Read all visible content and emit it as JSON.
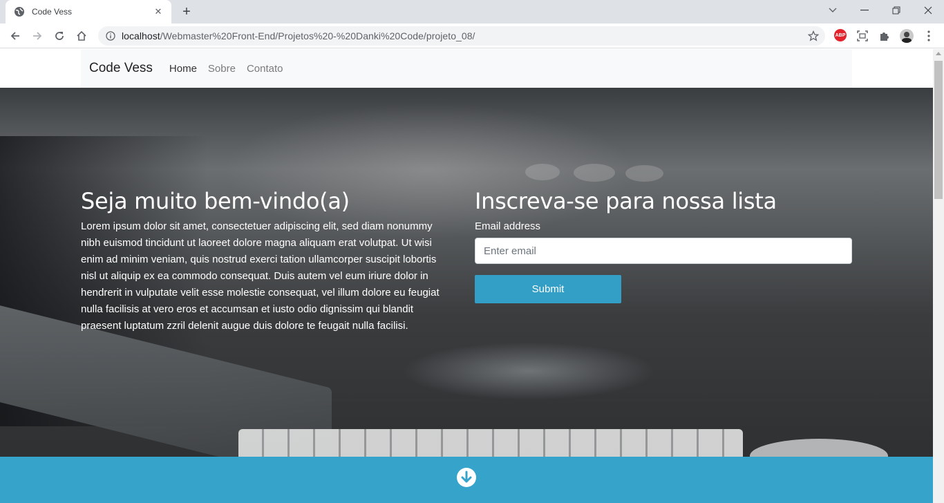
{
  "browser": {
    "tab_title": "Code Vess",
    "url_host": "localhost",
    "url_path": "/Webmaster%20Front-End/Projetos%20-%20Danki%20Code/projeto_08/",
    "abp_label": "ABP"
  },
  "navbar": {
    "brand": "Code Vess",
    "links": [
      "Home",
      "Sobre",
      "Contato"
    ]
  },
  "hero": {
    "title": "Seja muito bem-vindo(a)",
    "text": "Lorem ipsum dolor sit amet, consectetuer adipiscing elit, sed diam nonummy nibh euismod tincidunt ut laoreet dolore magna aliquam erat volutpat. Ut wisi enim ad minim veniam, quis nostrud exerci tation ullamcorper suscipit lobortis nisl ut aliquip ex ea commodo consequat. Duis autem vel eum iriure dolor in hendrerit in vulputate velit esse molestie consequat, vel illum dolore eu feugiat nulla facilisis at vero eros et accumsan et iusto odio dignissim qui blandit praesent luptatum zzril delenit augue duis dolore te feugait nulla facilisi."
  },
  "signup": {
    "title": "Inscreva-se para nossa lista",
    "email_label": "Email address",
    "email_placeholder": "Enter email",
    "submit_label": "Submit"
  },
  "colors": {
    "accent": "#36a3ca",
    "button": "#339fc7",
    "abp": "#e3232c"
  },
  "icons": {
    "tab": "globe-icon",
    "scroll_down": "arrow-down-circle-icon"
  }
}
